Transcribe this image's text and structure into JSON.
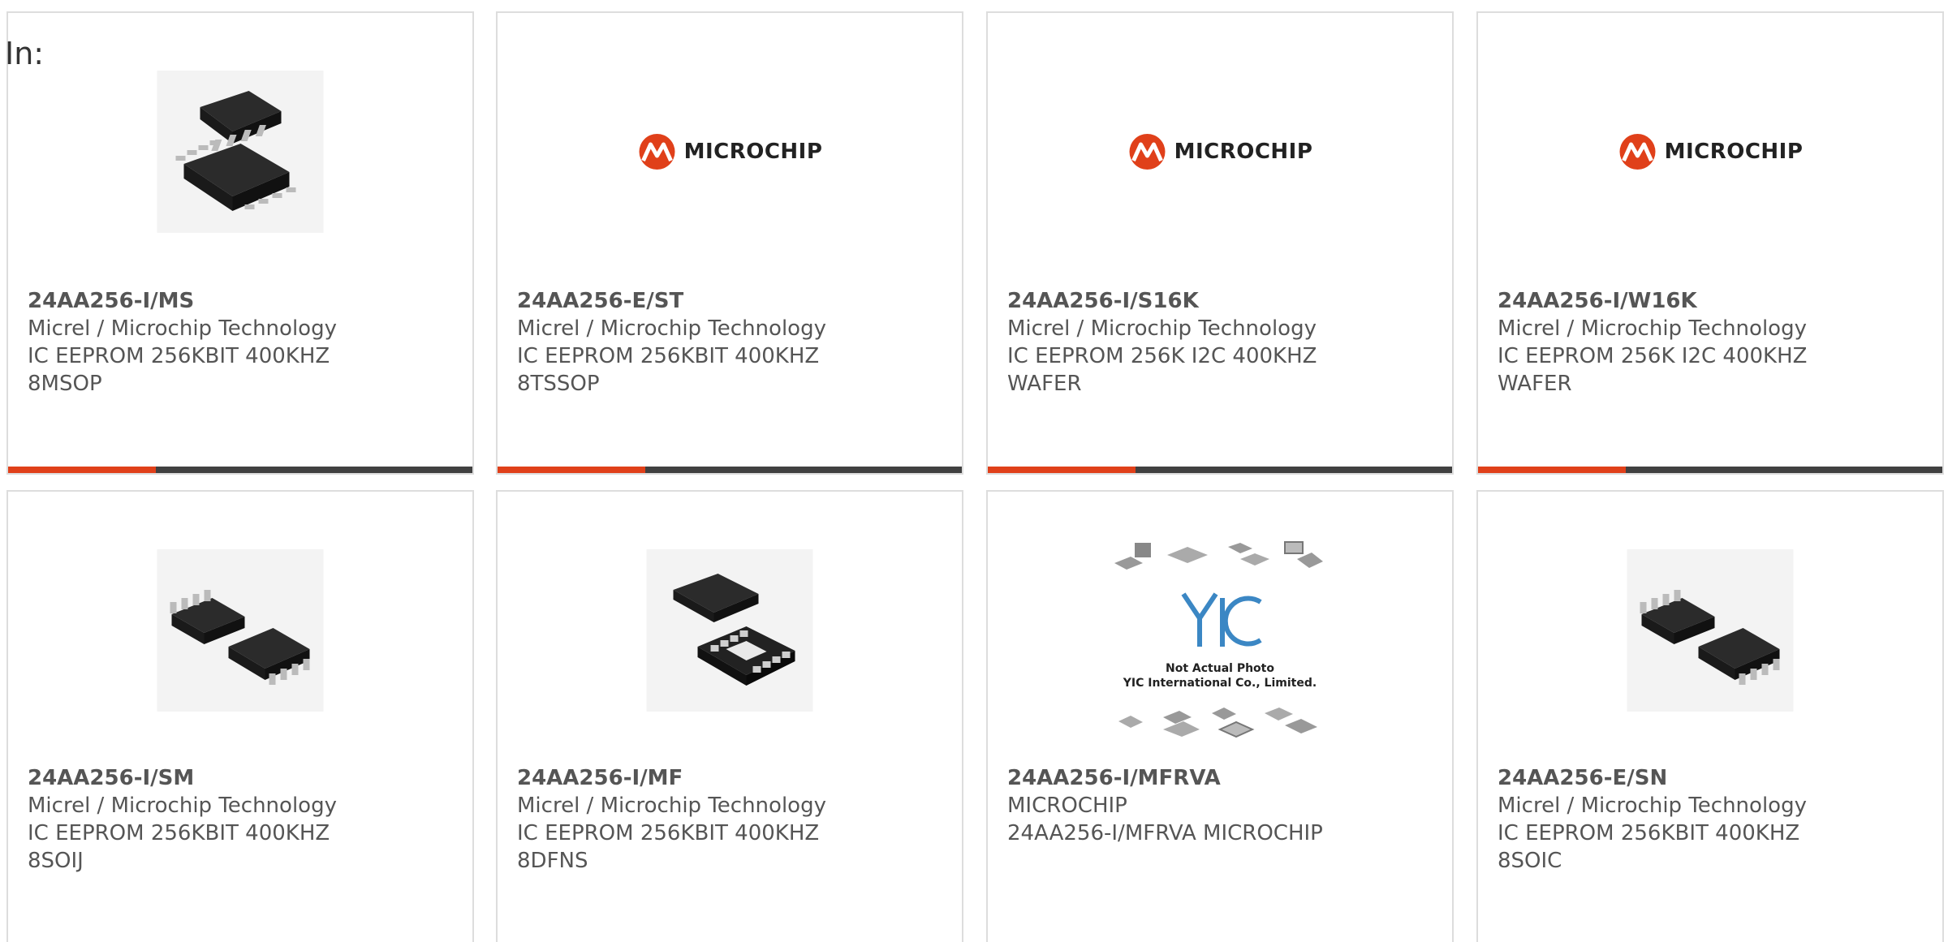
{
  "header": {
    "in_label": "In:"
  },
  "colors": {
    "accent": "#e0401a",
    "bar": "#404040",
    "border": "#dddddd",
    "text": "#555555"
  },
  "cards": [
    {
      "part_number": "24AA256-I/MS",
      "manufacturer": "Micrel / Microchip Technology",
      "desc1": "IC EEPROM 256KBIT 400KHZ",
      "desc2": "8MSOP",
      "image": "msop8-chip-photo"
    },
    {
      "part_number": "24AA256-E/ST",
      "manufacturer": "Micrel / Microchip Technology",
      "desc1": "IC EEPROM 256KBIT 400KHZ",
      "desc2": "8TSSOP",
      "image": "microchip-logo",
      "logo_text": "MICROCHIP"
    },
    {
      "part_number": "24AA256-I/S16K",
      "manufacturer": "Micrel / Microchip Technology",
      "desc1": "IC EEPROM 256K I2C 400KHZ",
      "desc2": "WAFER",
      "image": "microchip-logo",
      "logo_text": "MICROCHIP"
    },
    {
      "part_number": "24AA256-I/W16K",
      "manufacturer": "Micrel / Microchip Technology",
      "desc1": "IC EEPROM 256K I2C 400KHZ",
      "desc2": "WAFER",
      "image": "microchip-logo",
      "logo_text": "MICROCHIP"
    },
    {
      "part_number": "24AA256-I/SM",
      "manufacturer": "Micrel / Microchip Technology",
      "desc1": "IC EEPROM 256KBIT 400KHZ",
      "desc2": "8SOIJ",
      "image": "soij8-chip-photo"
    },
    {
      "part_number": "24AA256-I/MF",
      "manufacturer": "Micrel / Microchip Technology",
      "desc1": "IC EEPROM 256KBIT 400KHZ",
      "desc2": "8DFNS",
      "image": "dfn8-chip-photo"
    },
    {
      "part_number": "24AA256-I/MFRVA",
      "manufacturer": "MICROCHIP",
      "desc1": "24AA256-I/MFRVA MICROCHIP",
      "desc2": "",
      "image": "yic-placeholder",
      "yic_caption_1": "Not Actual Photo",
      "yic_caption_2": "YIC International Co., Limited."
    },
    {
      "part_number": "24AA256-E/SN",
      "manufacturer": "Micrel / Microchip Technology",
      "desc1": "IC EEPROM 256KBIT 400KHZ",
      "desc2": "8SOIC",
      "image": "soic8-chip-photo"
    }
  ]
}
